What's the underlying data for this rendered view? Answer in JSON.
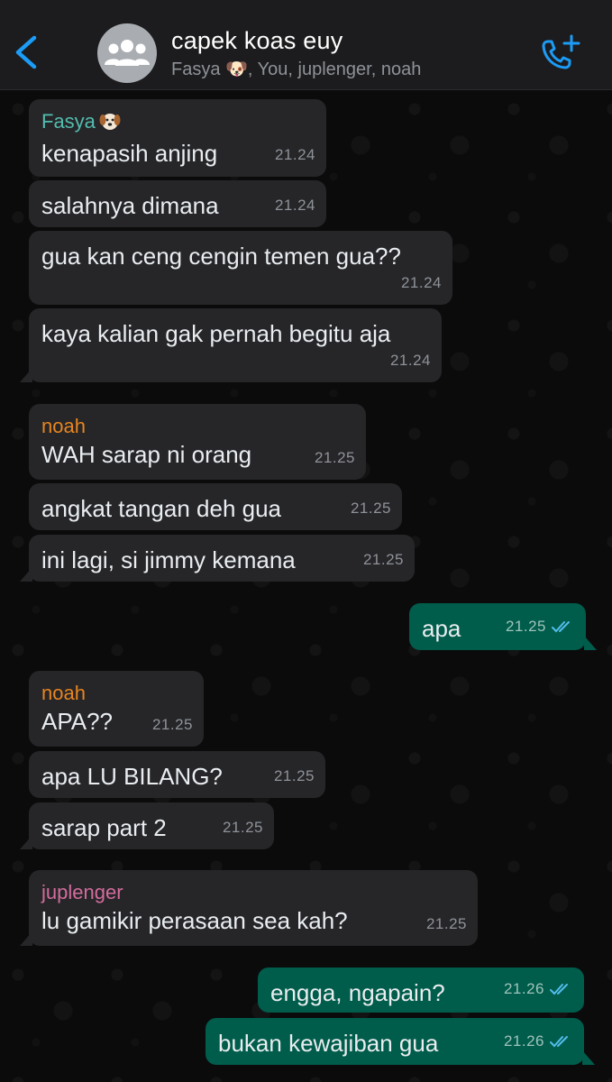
{
  "header": {
    "title": "capek koas euy",
    "participants": "Fasya 🐶, You, juplenger, noah"
  },
  "colors": {
    "incoming_bubble": "#262629",
    "outgoing_bubble": "#005c4b",
    "accent": "#1c9cf6",
    "name_fasya": "#53bdae",
    "name_noah": "#e8851f",
    "name_juplenger": "#d36c9c",
    "read_ticks": "#53bdeb"
  },
  "messages": [
    {
      "sender": "Fasya",
      "text": "kenapasih anjing",
      "time": "21.24"
    },
    {
      "text": "salahnya dimana",
      "time": "21.24"
    },
    {
      "text": "gua kan ceng cengin temen gua??",
      "time": "21.24"
    },
    {
      "text": "kaya kalian gak pernah begitu aja",
      "time": "21.24"
    },
    {
      "sender": "noah",
      "text": "WAH sarap ni orang",
      "time": "21.25"
    },
    {
      "text": "angkat tangan deh gua",
      "time": "21.25"
    },
    {
      "text": "ini lagi, si jimmy kemana",
      "time": "21.25"
    },
    {
      "text": "apa",
      "time": "21.25"
    },
    {
      "sender": "noah",
      "text": "APA??",
      "time": "21.25"
    },
    {
      "text": "apa LU BILANG?",
      "time": "21.25"
    },
    {
      "text": "sarap part 2",
      "time": "21.25"
    },
    {
      "sender": "juplenger",
      "text": "lu gamikir perasaan sea kah?",
      "time": "21.25"
    },
    {
      "text": "engga, ngapain?",
      "time": "21.26"
    },
    {
      "text": "bukan kewajiban gua",
      "time": "21.26"
    }
  ]
}
